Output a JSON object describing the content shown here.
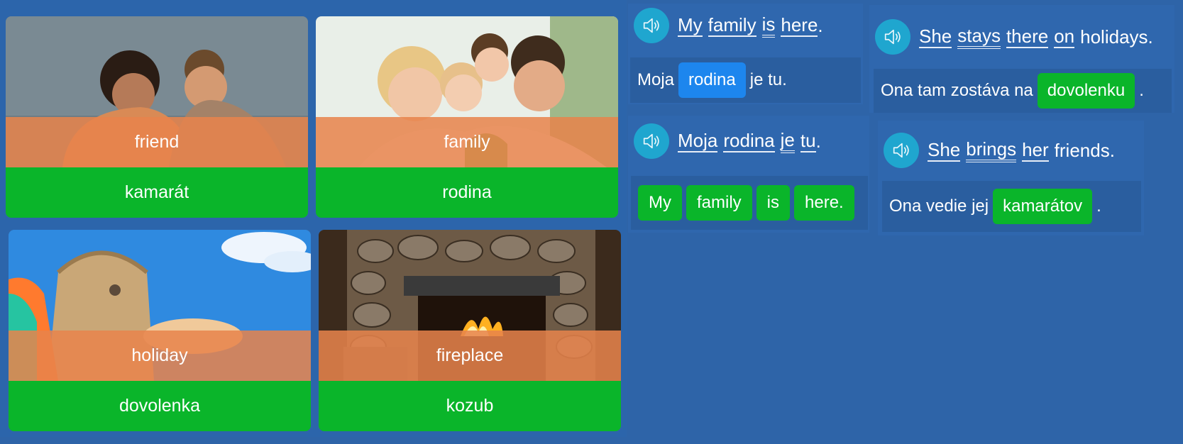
{
  "cards": [
    {
      "english": "friend",
      "slovak": "kamarát",
      "image": "two-friends-laughing"
    },
    {
      "english": "family",
      "slovak": "rodina",
      "image": "happy-family"
    },
    {
      "english": "holiday",
      "slovak": "dovolenka",
      "image": "beach-bag-sky"
    },
    {
      "english": "fireplace",
      "slovak": "kozub",
      "image": "stone-fireplace"
    }
  ],
  "sentence1": {
    "words": [
      "My",
      "family",
      "is",
      "here"
    ],
    "punct": ".",
    "translation_before": "Moja",
    "translation_highlight": "rodina",
    "translation_after": "je tu."
  },
  "sentence2": {
    "words": [
      "Moja",
      "rodina",
      "je",
      "tu"
    ],
    "punct": ".",
    "tiles": [
      "My",
      "family",
      "is",
      "here."
    ]
  },
  "sentence3": {
    "words": [
      "She",
      "stays",
      "there",
      "on",
      "holidays"
    ],
    "punct": ".",
    "translation_before": "Ona tam zostáva na",
    "translation_highlight": "dovolenku",
    "translation_after": "."
  },
  "sentence4": {
    "words": [
      "She",
      "brings",
      "her",
      "friends"
    ],
    "punct": ".",
    "translation_before": "Ona vedie jej",
    "translation_highlight": "kamarátov",
    "translation_after": "."
  },
  "colors": {
    "background": "#2e64a8",
    "english_band": "#e8844c",
    "slovak_band": "#0ab52a",
    "highlight_blue": "#1d86ee",
    "speaker": "#1fa6cf"
  },
  "icons": [
    "speaker-icon"
  ]
}
